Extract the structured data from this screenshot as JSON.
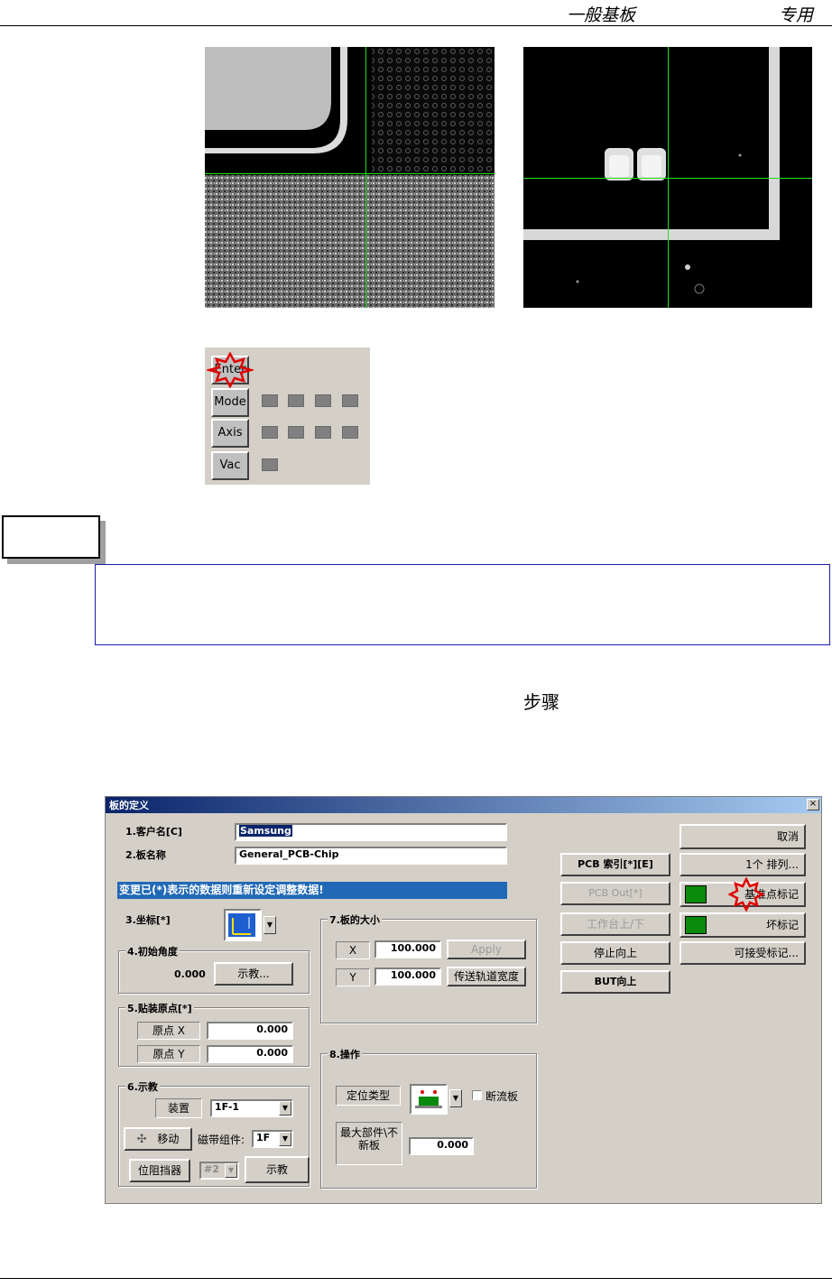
{
  "header": {
    "title": "一般基板",
    "right": "专用"
  },
  "control_panel": {
    "buttons": [
      "Enter",
      "Mode",
      "Axis",
      "Vac"
    ],
    "indicators": {
      "mode": 4,
      "axis": 4,
      "vac": 1
    }
  },
  "step_heading": "步骤",
  "dialog": {
    "title": "板的定义",
    "close": "×",
    "customer_label": "1.客户名[C]",
    "customer_value": "Samsung",
    "board_label": "2.板名称",
    "board_value": "General_PCB-Chip",
    "warning": "变更已(*)表示的数据则重新设定调整数据!",
    "coord_label": "3.坐标[*]",
    "angle_group": "4.初始角度",
    "angle_value": "0.000",
    "teach_btn": "示教...",
    "origin_group": "5.贴装原点[*]",
    "origin_x_label": "原点 X",
    "origin_x_value": "0.000",
    "origin_y_label": "原点 Y",
    "origin_y_value": "0.000",
    "teach_group": "6.示教",
    "device_label": "装置",
    "device_value": "1F-1",
    "move_btn": "移动",
    "tape_label": "磁带组件:",
    "tape_value": "1F",
    "stopper_btn": "位阻挡器",
    "stopper_value": "#2",
    "teach2_btn": "示教",
    "size_group": "7.板的大小",
    "x_label": "X",
    "x_value": "100.000",
    "apply_btn": "Apply",
    "y_label": "Y",
    "y_value": "100.000",
    "conveyor_btn": "传送轨道宽度",
    "op_group": "8.操作",
    "locate_type": "定位类型",
    "break_board": "断流板",
    "max_parts": "最大部件\\不新板",
    "max_parts_value": "0.000",
    "pcb_index": "PCB 索引[*][E]",
    "pcb_out": "PCB Out[*]",
    "table_up": "工作台上/下",
    "stop_up": "停止向上",
    "but_up": "BUT向上",
    "cancel": "取消",
    "array": "1个    排列...",
    "fiducial": "基准点标记",
    "bad_mark": "坏标记",
    "accept_mark": "可接受标记..."
  },
  "colors": {
    "title_start": "#0a246a",
    "title_end": "#a6caf0",
    "warning_bg": "#2169b6",
    "green_swatch": "#0a8a0a",
    "crosshair": "#1ee31e",
    "highlight": "#e00000"
  }
}
